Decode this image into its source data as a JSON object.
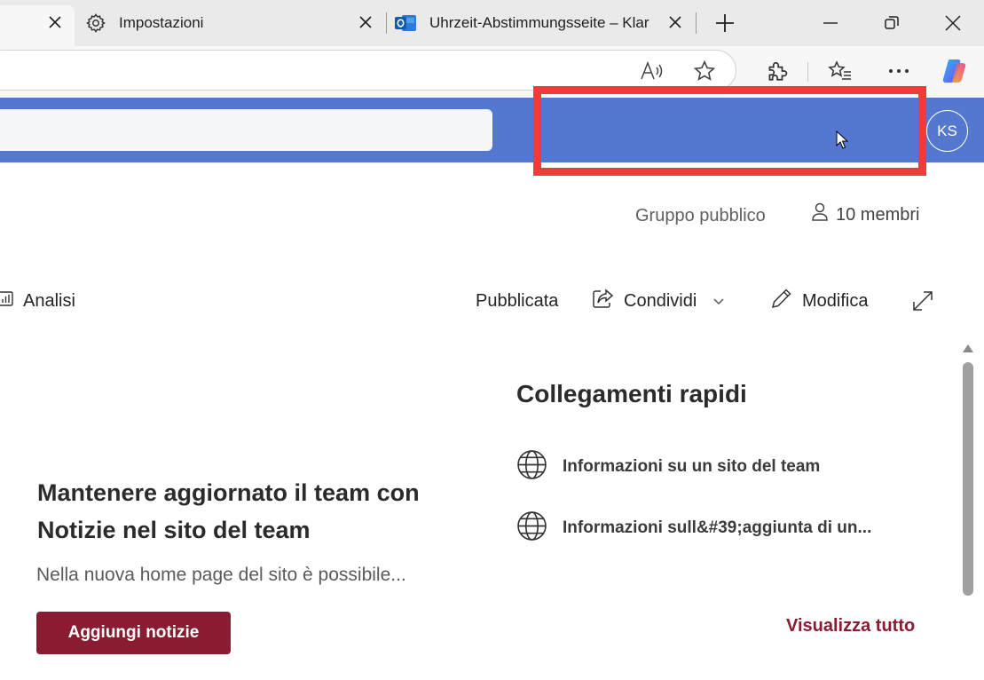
{
  "browser": {
    "tabs": [
      {
        "title": "",
        "active": true
      },
      {
        "title": "Impostazioni",
        "icon": "gear-icon"
      },
      {
        "title": "Uhrzeit-Abstimmungsseite – Klar",
        "icon": "outlook-icon"
      }
    ],
    "toolbar_icons": [
      "read-aloud-icon",
      "favorite-star-icon",
      "extensions-icon",
      "favorites-icon",
      "more-icon",
      "copilot-icon"
    ]
  },
  "suitebar": {
    "background": "#5478cf",
    "avatar_initials": "KS"
  },
  "highlight": {
    "color": "#f03b3b"
  },
  "site": {
    "visibility": "Gruppo pubblico",
    "members": "10 membri"
  },
  "commandbar": {
    "analytics": "Analisi",
    "published": "Pubblicata",
    "share": "Condividi",
    "edit": "Modifica"
  },
  "news": {
    "title": "Mantenere aggiornato il team con Notizie nel sito del team",
    "description": "Nella nuova home page del sito è possibile...",
    "button": "Aggiungi notizie",
    "accent": "#8a1c31"
  },
  "quick_links": {
    "title": "Collegamenti rapidi",
    "items": [
      {
        "label": "Informazioni su un sito del team",
        "icon": "globe-icon"
      },
      {
        "label": "Informazioni sull&#39;aggiunta di un...",
        "icon": "globe-icon"
      }
    ],
    "view_all": "Visualizza tutto"
  }
}
